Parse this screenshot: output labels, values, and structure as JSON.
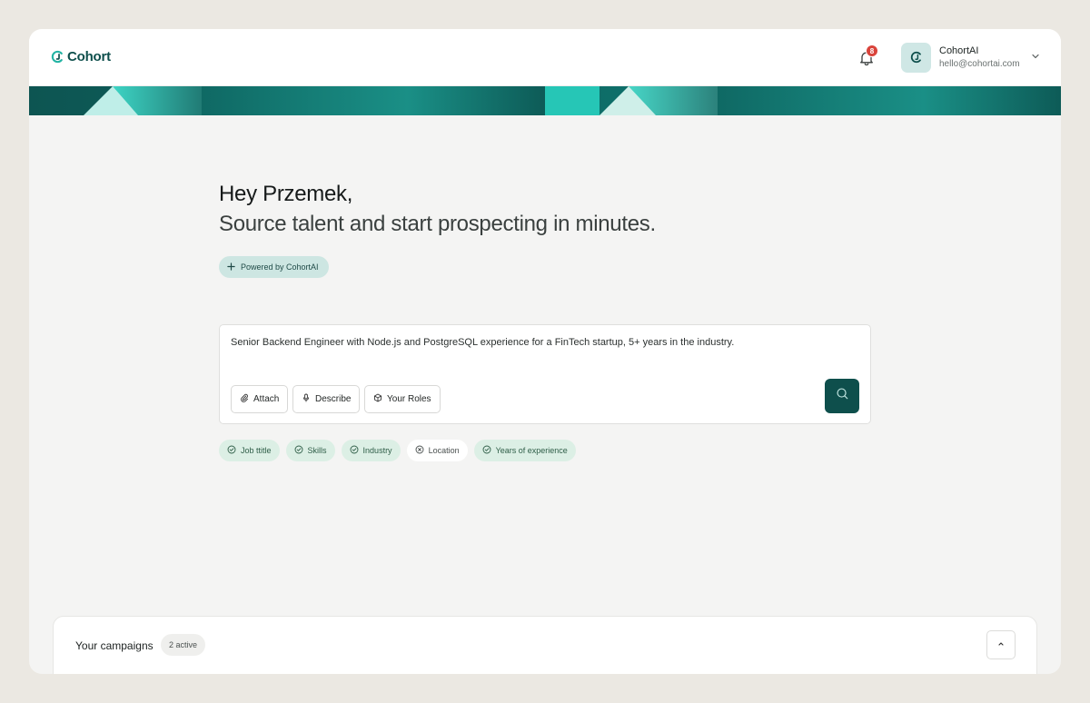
{
  "header": {
    "logo_text": "Cohort",
    "notifications_count": "8",
    "account": {
      "name": "CohortAI",
      "email": "hello@cohortai.com"
    }
  },
  "hero": {
    "greeting": "Hey Przemek,",
    "subtitle": "Source talent and start prospecting in minutes.",
    "powered_label": "Powered by CohortAI"
  },
  "search": {
    "query": "Senior Backend Engineer with Node.js and PostgreSQL experience for a FinTech startup, 5+ years in the industry.",
    "buttons": {
      "attach": "Attach",
      "describe": "Describe",
      "roles": "Your Roles"
    }
  },
  "criteria_chips": [
    {
      "label": "Job ttitle",
      "checked": true
    },
    {
      "label": "Skills",
      "checked": true
    },
    {
      "label": "Industry",
      "checked": true
    },
    {
      "label": "Location",
      "checked": false
    },
    {
      "label": "Years of experience",
      "checked": true
    }
  ],
  "campaigns": {
    "title": "Your campaigns",
    "badge": "2 active"
  },
  "colors": {
    "brand": "#0e4f4c",
    "accent": "#2bb5a6",
    "badge": "#d9433b",
    "chip_active_bg": "#dcefe5",
    "page_bg": "#f4f4f3"
  },
  "icons": {
    "logo": "cohort-logo-icon",
    "notifications": "bell-icon",
    "account_menu": "chevron-down-icon",
    "powered": "sparkle-icon",
    "attach": "paperclip-icon",
    "describe": "microphone-icon",
    "roles": "cube-icon",
    "search": "search-icon",
    "chip_checked": "check-circle-icon",
    "chip_unchecked": "x-circle-icon",
    "collapse": "chevron-up-icon"
  }
}
